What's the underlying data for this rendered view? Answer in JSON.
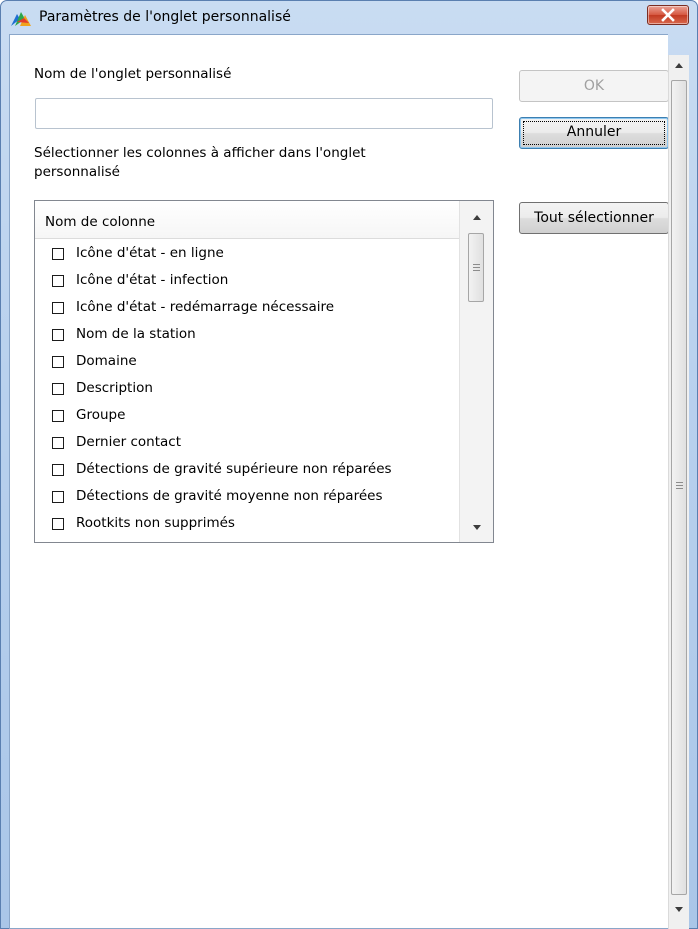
{
  "window": {
    "title": "Paramètres de l'onglet personnalisé"
  },
  "form": {
    "name_label": "Nom de l'onglet personnalisé",
    "name_value": "",
    "columns_label_line1": "Sélectionner les colonnes à afficher dans l'onglet",
    "columns_label_line2": "personnalisé"
  },
  "buttons": {
    "ok": "OK",
    "cancel": "Annuler",
    "select_all": "Tout sélectionner"
  },
  "columns_list": {
    "header": "Nom de colonne",
    "items": [
      {
        "label": "Icône d'état - en ligne",
        "checked": false
      },
      {
        "label": "Icône d'état - infection",
        "checked": false
      },
      {
        "label": "Icône d'état - redémarrage nécessaire",
        "checked": false
      },
      {
        "label": "Nom de la station",
        "checked": false
      },
      {
        "label": "Domaine",
        "checked": false
      },
      {
        "label": "Description",
        "checked": false
      },
      {
        "label": "Groupe",
        "checked": false
      },
      {
        "label": "Dernier contact",
        "checked": false
      },
      {
        "label": "Détections de gravité supérieure non réparées",
        "checked": false
      },
      {
        "label": "Détections de gravité moyenne non réparées",
        "checked": false
      },
      {
        "label": "Rootkits non supprimés",
        "checked": false
      }
    ]
  },
  "icons": {
    "app": "avg-logo-icon",
    "close": "close-icon"
  }
}
